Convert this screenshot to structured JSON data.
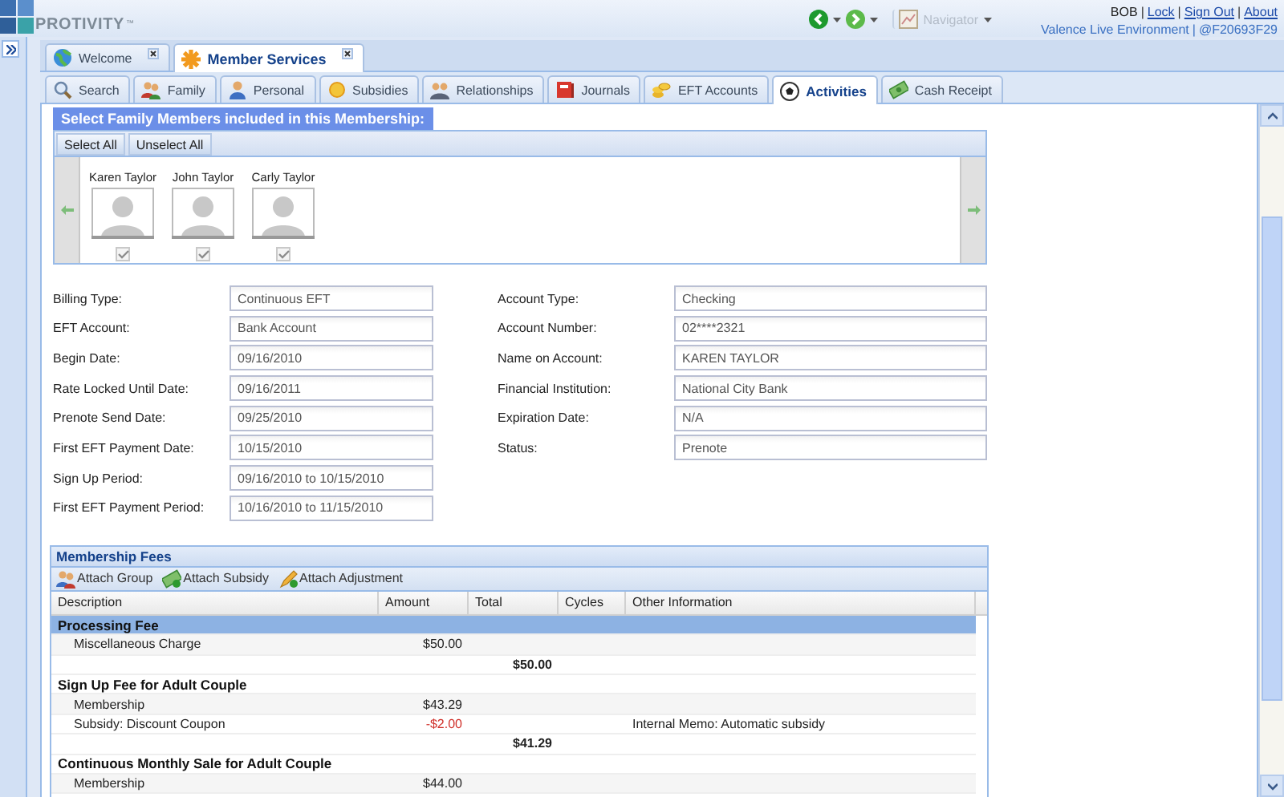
{
  "header": {
    "logo": "PROTIVITY",
    "logo_mark": "™",
    "navigator": {
      "label": "Navigator",
      "disabled": true
    },
    "user": "BOB",
    "separator": "|",
    "links": [
      "Lock",
      "Sign Out",
      "About"
    ],
    "environment": [
      "Valence Live Environment",
      "@F20693F29"
    ]
  },
  "outer_tabs": [
    {
      "label": "Welcome",
      "selected": false
    },
    {
      "label": "Member Services",
      "selected": true
    }
  ],
  "inner_tabs": [
    {
      "label": "Search",
      "selected": false
    },
    {
      "label": "Family",
      "selected": false
    },
    {
      "label": "Personal",
      "selected": false
    },
    {
      "label": "Subsidies",
      "selected": false
    },
    {
      "label": "Relationships",
      "selected": false
    },
    {
      "label": "Journals",
      "selected": false
    },
    {
      "label": "EFT Accounts",
      "selected": false
    },
    {
      "label": "Activities",
      "selected": true
    },
    {
      "label": "Cash Receipt",
      "selected": false
    }
  ],
  "family": {
    "title": "Select Family Members included in this Membership:",
    "buttons": [
      "Select All",
      "Unselect All"
    ],
    "members": [
      {
        "name": "Karen Taylor",
        "checked": true
      },
      {
        "name": "John Taylor",
        "checked": true
      },
      {
        "name": "Carly Taylor",
        "checked": true
      }
    ]
  },
  "account": {
    "left": [
      {
        "label": "Billing Type:",
        "value": "Continuous EFT"
      },
      {
        "label": "EFT Account:",
        "value": "Bank Account"
      },
      {
        "label": "Begin Date:",
        "value": "09/16/2010"
      },
      {
        "label": "Rate Locked Until Date:",
        "value": "09/16/2011"
      },
      {
        "label": "Prenote Send Date:",
        "value": "09/25/2010"
      },
      {
        "label": "First EFT Payment Date:",
        "value": "10/15/2010"
      },
      {
        "label": "Sign Up Period:",
        "value": "09/16/2010 to 10/15/2010"
      },
      {
        "label": "First EFT Payment Period:",
        "value": "10/16/2010 to 11/15/2010"
      }
    ],
    "right": [
      {
        "label": "Account Type:",
        "value": "Checking"
      },
      {
        "label": "Account Number:",
        "value": "02****2321"
      },
      {
        "label": "Name on Account:",
        "value": "KAREN TAYLOR"
      },
      {
        "label": "Financial Institution:",
        "value": "National City Bank"
      },
      {
        "label": "Expiration Date:",
        "value": "N/A"
      },
      {
        "label": "Status:",
        "value": "Prenote"
      }
    ]
  },
  "fees": {
    "title": "Membership Fees",
    "actions": [
      "Attach Group",
      "Attach Subsidy",
      "Attach Adjustment"
    ],
    "columns": [
      "Description",
      "Amount",
      "Total",
      "Cycles",
      "Other Information"
    ],
    "rows": [
      {
        "kind": "group",
        "description": "Processing Fee",
        "selected": true
      },
      {
        "kind": "item",
        "description": "Miscellaneous Charge",
        "amount": "$50.00"
      },
      {
        "kind": "total",
        "total": "$50.00"
      },
      {
        "kind": "group",
        "description": "Sign Up Fee for Adult Couple",
        "selected": false
      },
      {
        "kind": "item",
        "description": "Membership",
        "amount": "$43.29"
      },
      {
        "kind": "discount",
        "description": "Subsidy: Discount Coupon",
        "amount": "-$2.00",
        "other": "Internal Memo: Automatic subsidy"
      },
      {
        "kind": "total",
        "total": "$41.29"
      },
      {
        "kind": "group",
        "description": "Continuous Monthly Sale for Adult Couple",
        "selected": false
      },
      {
        "kind": "item",
        "description": "Membership",
        "amount": "$44.00"
      }
    ]
  }
}
